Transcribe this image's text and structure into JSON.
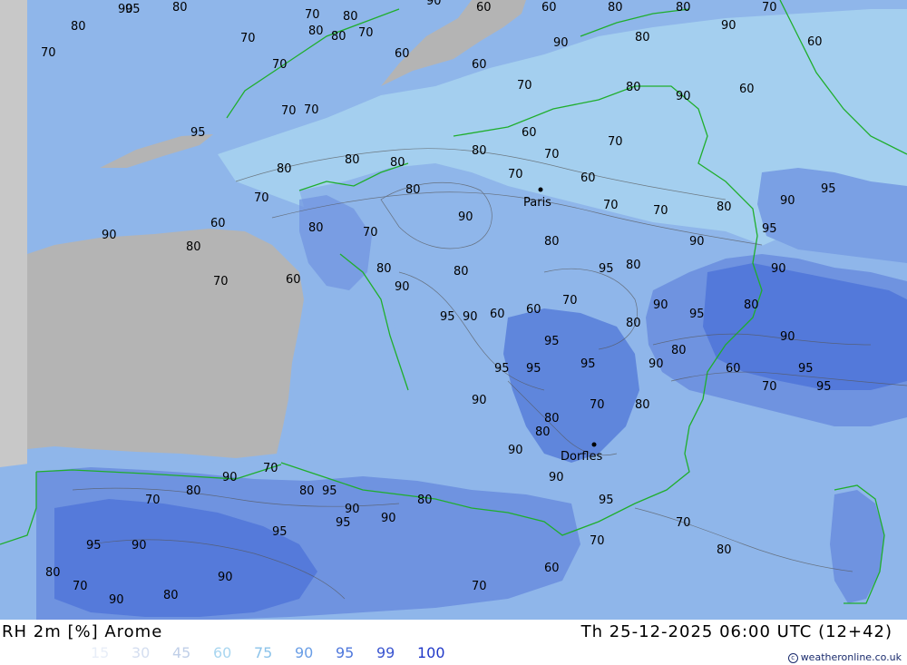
{
  "footer": {
    "title": "RH 2m [%] Arome",
    "timestamp": "Th 25-12-2025 06:00 UTC (12+42)",
    "credit": "weatheronline.co.uk"
  },
  "legend": [
    {
      "label": "15",
      "color": "#e8eef8"
    },
    {
      "label": "30",
      "color": "#d4def0"
    },
    {
      "label": "45",
      "color": "#c0cfe8"
    },
    {
      "label": "60",
      "color": "#a9d6f0"
    },
    {
      "label": "75",
      "color": "#8cc3ea"
    },
    {
      "label": "90",
      "color": "#6a9ee6"
    },
    {
      "label": "95",
      "color": "#4f78dc"
    },
    {
      "label": "99",
      "color": "#3a55d0"
    },
    {
      "label": "100",
      "color": "#2038c8"
    }
  ],
  "colors": {
    "land_low": "#a9d6f0",
    "land_mid": "#8fb6ea",
    "land_high": "#6f93e0",
    "land_very_high": "#4f74d8",
    "sea_grey": "#b4b4b4",
    "border": "#1fae2c",
    "contour": "#555555"
  },
  "cities": [
    {
      "name": "Paris"
    },
    {
      "name": "Dorfles"
    }
  ],
  "contour_labels": [
    "90",
    "80",
    "80",
    "70",
    "80",
    "80",
    "60",
    "60",
    "70",
    "80",
    "95",
    "90",
    "95",
    "70",
    "80",
    "80",
    "70",
    "70",
    "60",
    "60",
    "60",
    "70",
    "80",
    "90",
    "80",
    "70",
    "70",
    "60",
    "80",
    "70",
    "60",
    "70",
    "80",
    "70",
    "80",
    "80",
    "70",
    "80",
    "60",
    "70",
    "80",
    "70",
    "90",
    "80",
    "80",
    "90",
    "70",
    "60",
    "60",
    "80",
    "90",
    "70",
    "80",
    "90",
    "95",
    "80",
    "90",
    "70",
    "80",
    "95",
    "90",
    "95",
    "90",
    "80",
    "90",
    "95",
    "70",
    "60",
    "80",
    "95",
    "90",
    "80",
    "70",
    "60",
    "60",
    "90",
    "95",
    "90",
    "95",
    "95",
    "90",
    "80",
    "70",
    "80",
    "90",
    "95",
    "95",
    "90",
    "80",
    "90",
    "95",
    "70",
    "80",
    "70",
    "60",
    "70",
    "80",
    "90",
    "95",
    "95",
    "90",
    "80",
    "90",
    "70",
    "80",
    "95",
    "90",
    "70",
    "80",
    "90",
    "70",
    "80",
    "90",
    "95",
    "95"
  ]
}
